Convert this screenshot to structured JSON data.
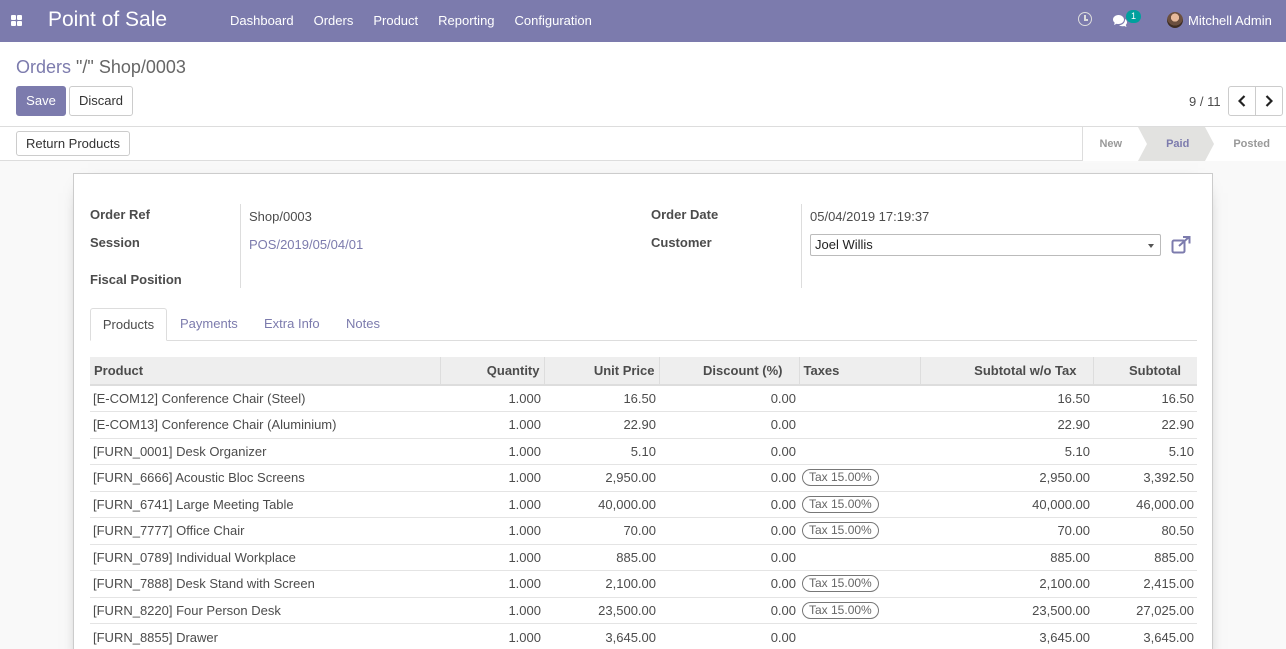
{
  "navbar": {
    "brand": "Point of Sale",
    "menu": [
      "Dashboard",
      "Orders",
      "Product",
      "Reporting",
      "Configuration"
    ],
    "chat_count": "1",
    "user": "Mitchell Admin"
  },
  "control_panel": {
    "breadcrumb_parent": "Orders",
    "breadcrumb_sep": " \"/\" ",
    "breadcrumb_current": "Shop/0003",
    "save_label": "Save",
    "discard_label": "Discard",
    "pager": "9 / 11"
  },
  "statusbar": {
    "return_label": "Return Products",
    "stages": [
      "New",
      "Paid",
      "Posted"
    ],
    "active_stage": "Paid"
  },
  "form": {
    "order_ref_label": "Order Ref",
    "order_ref": "Shop/0003",
    "session_label": "Session",
    "session": "POS/2019/05/04/01",
    "fiscal_position_label": "Fiscal Position",
    "order_date_label": "Order Date",
    "order_date": "05/04/2019 17:19:37",
    "customer_label": "Customer",
    "customer": "Joel Willis"
  },
  "tabs": [
    "Products",
    "Payments",
    "Extra Info",
    "Notes"
  ],
  "lines": {
    "columns": [
      "Product",
      "Quantity",
      "Unit Price",
      "Discount (%)",
      "Taxes",
      "Subtotal w/o Tax",
      "Subtotal"
    ],
    "rows": [
      {
        "product": "[E-COM12] Conference Chair (Steel)",
        "qty": "1.000",
        "price": "16.50",
        "discount": "0.00",
        "tax": "",
        "subtotal_wo": "16.50",
        "subtotal": "16.50"
      },
      {
        "product": "[E-COM13] Conference Chair (Aluminium)",
        "qty": "1.000",
        "price": "22.90",
        "discount": "0.00",
        "tax": "",
        "subtotal_wo": "22.90",
        "subtotal": "22.90"
      },
      {
        "product": "[FURN_0001] Desk Organizer",
        "qty": "1.000",
        "price": "5.10",
        "discount": "0.00",
        "tax": "",
        "subtotal_wo": "5.10",
        "subtotal": "5.10"
      },
      {
        "product": "[FURN_6666] Acoustic Bloc Screens",
        "qty": "1.000",
        "price": "2,950.00",
        "discount": "0.00",
        "tax": "Tax 15.00%",
        "subtotal_wo": "2,950.00",
        "subtotal": "3,392.50"
      },
      {
        "product": "[FURN_6741] Large Meeting Table",
        "qty": "1.000",
        "price": "40,000.00",
        "discount": "0.00",
        "tax": "Tax 15.00%",
        "subtotal_wo": "40,000.00",
        "subtotal": "46,000.00"
      },
      {
        "product": "[FURN_7777] Office Chair",
        "qty": "1.000",
        "price": "70.00",
        "discount": "0.00",
        "tax": "Tax 15.00%",
        "subtotal_wo": "70.00",
        "subtotal": "80.50"
      },
      {
        "product": "[FURN_0789] Individual Workplace",
        "qty": "1.000",
        "price": "885.00",
        "discount": "0.00",
        "tax": "",
        "subtotal_wo": "885.00",
        "subtotal": "885.00"
      },
      {
        "product": "[FURN_7888] Desk Stand with Screen",
        "qty": "1.000",
        "price": "2,100.00",
        "discount": "0.00",
        "tax": "Tax 15.00%",
        "subtotal_wo": "2,100.00",
        "subtotal": "2,415.00"
      },
      {
        "product": "[FURN_8220] Four Person Desk",
        "qty": "1.000",
        "price": "23,500.00",
        "discount": "0.00",
        "tax": "Tax 15.00%",
        "subtotal_wo": "23,500.00",
        "subtotal": "27,025.00"
      },
      {
        "product": "[FURN_8855] Drawer",
        "qty": "1.000",
        "price": "3,645.00",
        "discount": "0.00",
        "tax": "",
        "subtotal_wo": "3,645.00",
        "subtotal": "3,645.00"
      }
    ]
  },
  "colors": {
    "primary": "#7c7bad",
    "badge": "#00a09d"
  }
}
